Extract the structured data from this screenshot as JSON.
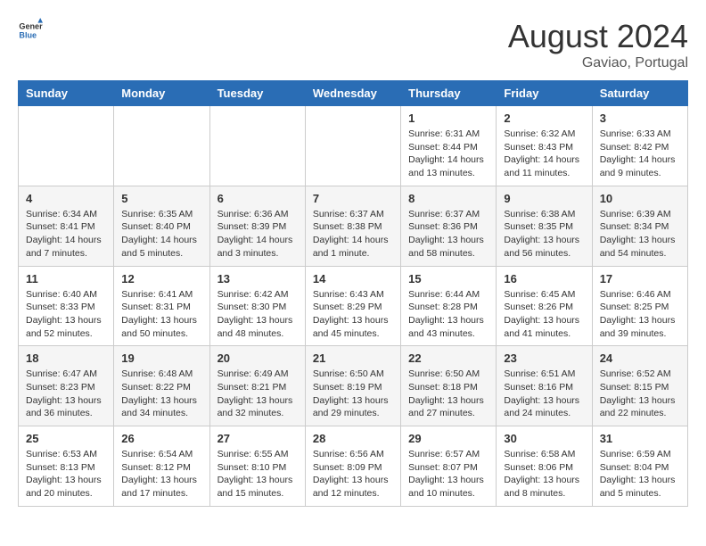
{
  "logo": {
    "line1": "General",
    "line2": "Blue"
  },
  "title": "August 2024",
  "subtitle": "Gaviao, Portugal",
  "weekdays": [
    "Sunday",
    "Monday",
    "Tuesday",
    "Wednesday",
    "Thursday",
    "Friday",
    "Saturday"
  ],
  "weeks": [
    [
      {
        "day": "",
        "info": ""
      },
      {
        "day": "",
        "info": ""
      },
      {
        "day": "",
        "info": ""
      },
      {
        "day": "",
        "info": ""
      },
      {
        "day": "1",
        "info": "Sunrise: 6:31 AM\nSunset: 8:44 PM\nDaylight: 14 hours\nand 13 minutes."
      },
      {
        "day": "2",
        "info": "Sunrise: 6:32 AM\nSunset: 8:43 PM\nDaylight: 14 hours\nand 11 minutes."
      },
      {
        "day": "3",
        "info": "Sunrise: 6:33 AM\nSunset: 8:42 PM\nDaylight: 14 hours\nand 9 minutes."
      }
    ],
    [
      {
        "day": "4",
        "info": "Sunrise: 6:34 AM\nSunset: 8:41 PM\nDaylight: 14 hours\nand 7 minutes."
      },
      {
        "day": "5",
        "info": "Sunrise: 6:35 AM\nSunset: 8:40 PM\nDaylight: 14 hours\nand 5 minutes."
      },
      {
        "day": "6",
        "info": "Sunrise: 6:36 AM\nSunset: 8:39 PM\nDaylight: 14 hours\nand 3 minutes."
      },
      {
        "day": "7",
        "info": "Sunrise: 6:37 AM\nSunset: 8:38 PM\nDaylight: 14 hours\nand 1 minute."
      },
      {
        "day": "8",
        "info": "Sunrise: 6:37 AM\nSunset: 8:36 PM\nDaylight: 13 hours\nand 58 minutes."
      },
      {
        "day": "9",
        "info": "Sunrise: 6:38 AM\nSunset: 8:35 PM\nDaylight: 13 hours\nand 56 minutes."
      },
      {
        "day": "10",
        "info": "Sunrise: 6:39 AM\nSunset: 8:34 PM\nDaylight: 13 hours\nand 54 minutes."
      }
    ],
    [
      {
        "day": "11",
        "info": "Sunrise: 6:40 AM\nSunset: 8:33 PM\nDaylight: 13 hours\nand 52 minutes."
      },
      {
        "day": "12",
        "info": "Sunrise: 6:41 AM\nSunset: 8:31 PM\nDaylight: 13 hours\nand 50 minutes."
      },
      {
        "day": "13",
        "info": "Sunrise: 6:42 AM\nSunset: 8:30 PM\nDaylight: 13 hours\nand 48 minutes."
      },
      {
        "day": "14",
        "info": "Sunrise: 6:43 AM\nSunset: 8:29 PM\nDaylight: 13 hours\nand 45 minutes."
      },
      {
        "day": "15",
        "info": "Sunrise: 6:44 AM\nSunset: 8:28 PM\nDaylight: 13 hours\nand 43 minutes."
      },
      {
        "day": "16",
        "info": "Sunrise: 6:45 AM\nSunset: 8:26 PM\nDaylight: 13 hours\nand 41 minutes."
      },
      {
        "day": "17",
        "info": "Sunrise: 6:46 AM\nSunset: 8:25 PM\nDaylight: 13 hours\nand 39 minutes."
      }
    ],
    [
      {
        "day": "18",
        "info": "Sunrise: 6:47 AM\nSunset: 8:23 PM\nDaylight: 13 hours\nand 36 minutes."
      },
      {
        "day": "19",
        "info": "Sunrise: 6:48 AM\nSunset: 8:22 PM\nDaylight: 13 hours\nand 34 minutes."
      },
      {
        "day": "20",
        "info": "Sunrise: 6:49 AM\nSunset: 8:21 PM\nDaylight: 13 hours\nand 32 minutes."
      },
      {
        "day": "21",
        "info": "Sunrise: 6:50 AM\nSunset: 8:19 PM\nDaylight: 13 hours\nand 29 minutes."
      },
      {
        "day": "22",
        "info": "Sunrise: 6:50 AM\nSunset: 8:18 PM\nDaylight: 13 hours\nand 27 minutes."
      },
      {
        "day": "23",
        "info": "Sunrise: 6:51 AM\nSunset: 8:16 PM\nDaylight: 13 hours\nand 24 minutes."
      },
      {
        "day": "24",
        "info": "Sunrise: 6:52 AM\nSunset: 8:15 PM\nDaylight: 13 hours\nand 22 minutes."
      }
    ],
    [
      {
        "day": "25",
        "info": "Sunrise: 6:53 AM\nSunset: 8:13 PM\nDaylight: 13 hours\nand 20 minutes."
      },
      {
        "day": "26",
        "info": "Sunrise: 6:54 AM\nSunset: 8:12 PM\nDaylight: 13 hours\nand 17 minutes."
      },
      {
        "day": "27",
        "info": "Sunrise: 6:55 AM\nSunset: 8:10 PM\nDaylight: 13 hours\nand 15 minutes."
      },
      {
        "day": "28",
        "info": "Sunrise: 6:56 AM\nSunset: 8:09 PM\nDaylight: 13 hours\nand 12 minutes."
      },
      {
        "day": "29",
        "info": "Sunrise: 6:57 AM\nSunset: 8:07 PM\nDaylight: 13 hours\nand 10 minutes."
      },
      {
        "day": "30",
        "info": "Sunrise: 6:58 AM\nSunset: 8:06 PM\nDaylight: 13 hours\nand 8 minutes."
      },
      {
        "day": "31",
        "info": "Sunrise: 6:59 AM\nSunset: 8:04 PM\nDaylight: 13 hours\nand 5 minutes."
      }
    ]
  ]
}
